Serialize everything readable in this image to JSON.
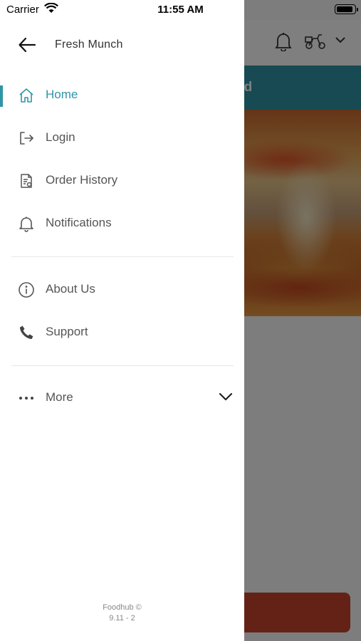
{
  "status_bar": {
    "carrier": "Carrier",
    "time": "11:55 AM"
  },
  "drawer": {
    "title": "Fresh Munch",
    "items": [
      {
        "label": "Home",
        "icon": "home-icon",
        "active": true
      },
      {
        "label": "Login",
        "icon": "login-icon"
      },
      {
        "label": "Order History",
        "icon": "receipt-icon"
      },
      {
        "label": "Notifications",
        "icon": "bell-icon"
      },
      {
        "label": "About Us",
        "icon": "info-icon"
      },
      {
        "label": "Support",
        "icon": "phone-icon"
      },
      {
        "label": "More",
        "icon": "more-dots-icon"
      }
    ],
    "footer": {
      "brand": "Foodhub ©",
      "version": "9.11 - 2"
    }
  },
  "background": {
    "banner_text": "ed"
  },
  "colors": {
    "accent": "#2f95a6",
    "overlay": "rgba(0,0,0,0.5)",
    "cta": "#c8452c"
  }
}
